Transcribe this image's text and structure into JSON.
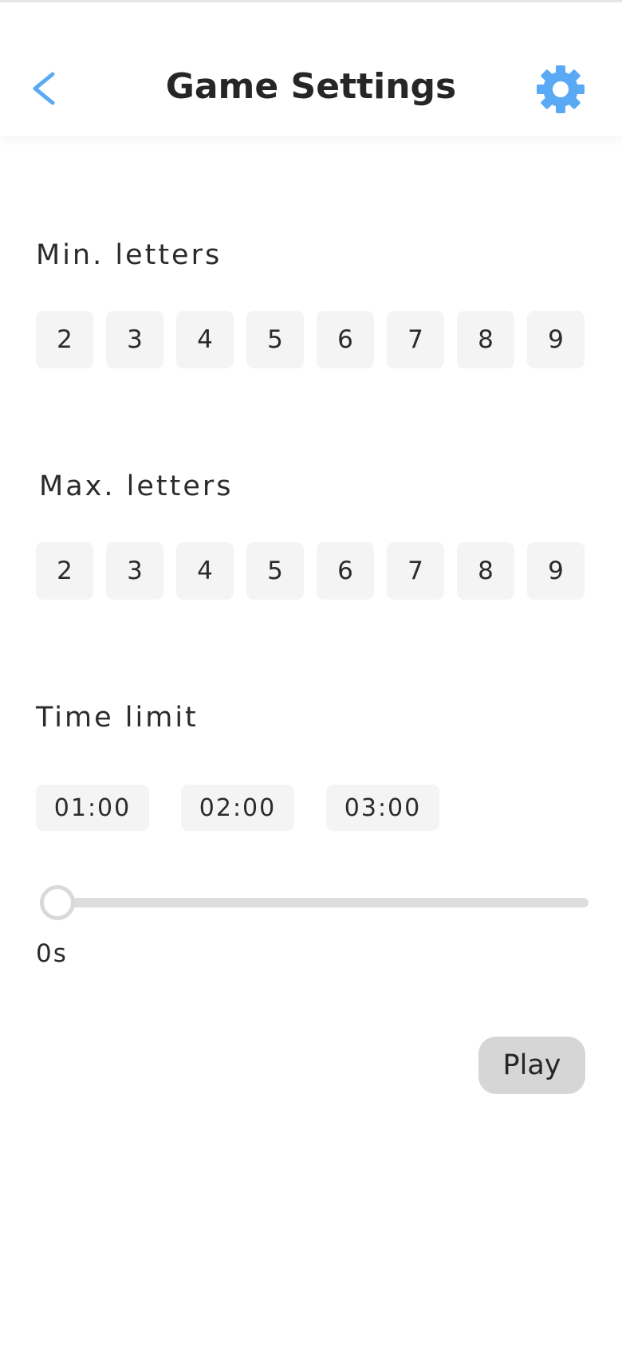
{
  "header": {
    "title": "Game Settings",
    "back_icon": "chevron-left-icon",
    "settings_icon": "gear-icon",
    "accent_color": "#5aa9f5"
  },
  "min_letters": {
    "label": "Min. letters",
    "options": [
      "2",
      "3",
      "4",
      "5",
      "6",
      "7",
      "8",
      "9"
    ]
  },
  "max_letters": {
    "label": "Max. letters",
    "options": [
      "2",
      "3",
      "4",
      "5",
      "6",
      "7",
      "8",
      "9"
    ]
  },
  "time_limit": {
    "label": "Time limit",
    "presets": [
      "01:00",
      "02:00",
      "03:00"
    ],
    "slider_value": 0,
    "value_text": "0s"
  },
  "play_button": {
    "label": "Play"
  }
}
